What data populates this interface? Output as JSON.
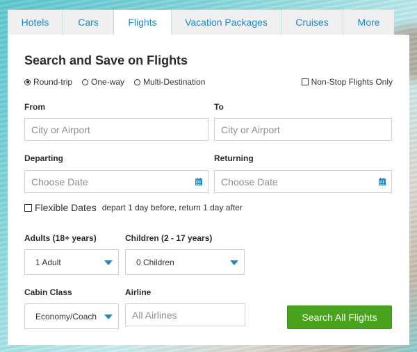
{
  "tabs": [
    {
      "label": "Hotels",
      "active": false
    },
    {
      "label": "Cars",
      "active": false
    },
    {
      "label": "Flights",
      "active": true
    },
    {
      "label": "Vacation Packages",
      "active": false
    },
    {
      "label": "Cruises",
      "active": false
    },
    {
      "label": "More",
      "active": false
    }
  ],
  "form": {
    "title": "Search and Save on Flights",
    "trip_types": [
      {
        "label": "Round-trip",
        "selected": true
      },
      {
        "label": "One-way",
        "selected": false
      },
      {
        "label": "Multi-Destination",
        "selected": false
      }
    ],
    "nonstop_label": "Non-Stop Flights Only",
    "nonstop_checked": false,
    "from": {
      "label": "From",
      "placeholder": "City or Airport",
      "value": ""
    },
    "to": {
      "label": "To",
      "placeholder": "City or Airport",
      "value": ""
    },
    "departing": {
      "label": "Departing",
      "placeholder": "Choose Date",
      "value": "",
      "icon": "calendar-icon"
    },
    "returning": {
      "label": "Returning",
      "placeholder": "Choose Date",
      "value": "",
      "icon": "calendar-icon"
    },
    "flexible": {
      "label": "Flexible Dates",
      "note": "depart 1 day before, return 1 day after",
      "checked": false
    },
    "adults": {
      "label": "Adults (18+ years)",
      "value": "1 Adult"
    },
    "children": {
      "label": "Children (2 - 17 years)",
      "value": "0 Children"
    },
    "cabin": {
      "label": "Cabin Class",
      "value": "Economy/Coach"
    },
    "airline": {
      "label": "Airline",
      "placeholder": "All Airlines",
      "value": ""
    },
    "submit_label": "Search All Flights"
  },
  "colors": {
    "accent": "#1e88c8",
    "button": "#4aa31e",
    "tab_bg": "#f0f0f0"
  }
}
